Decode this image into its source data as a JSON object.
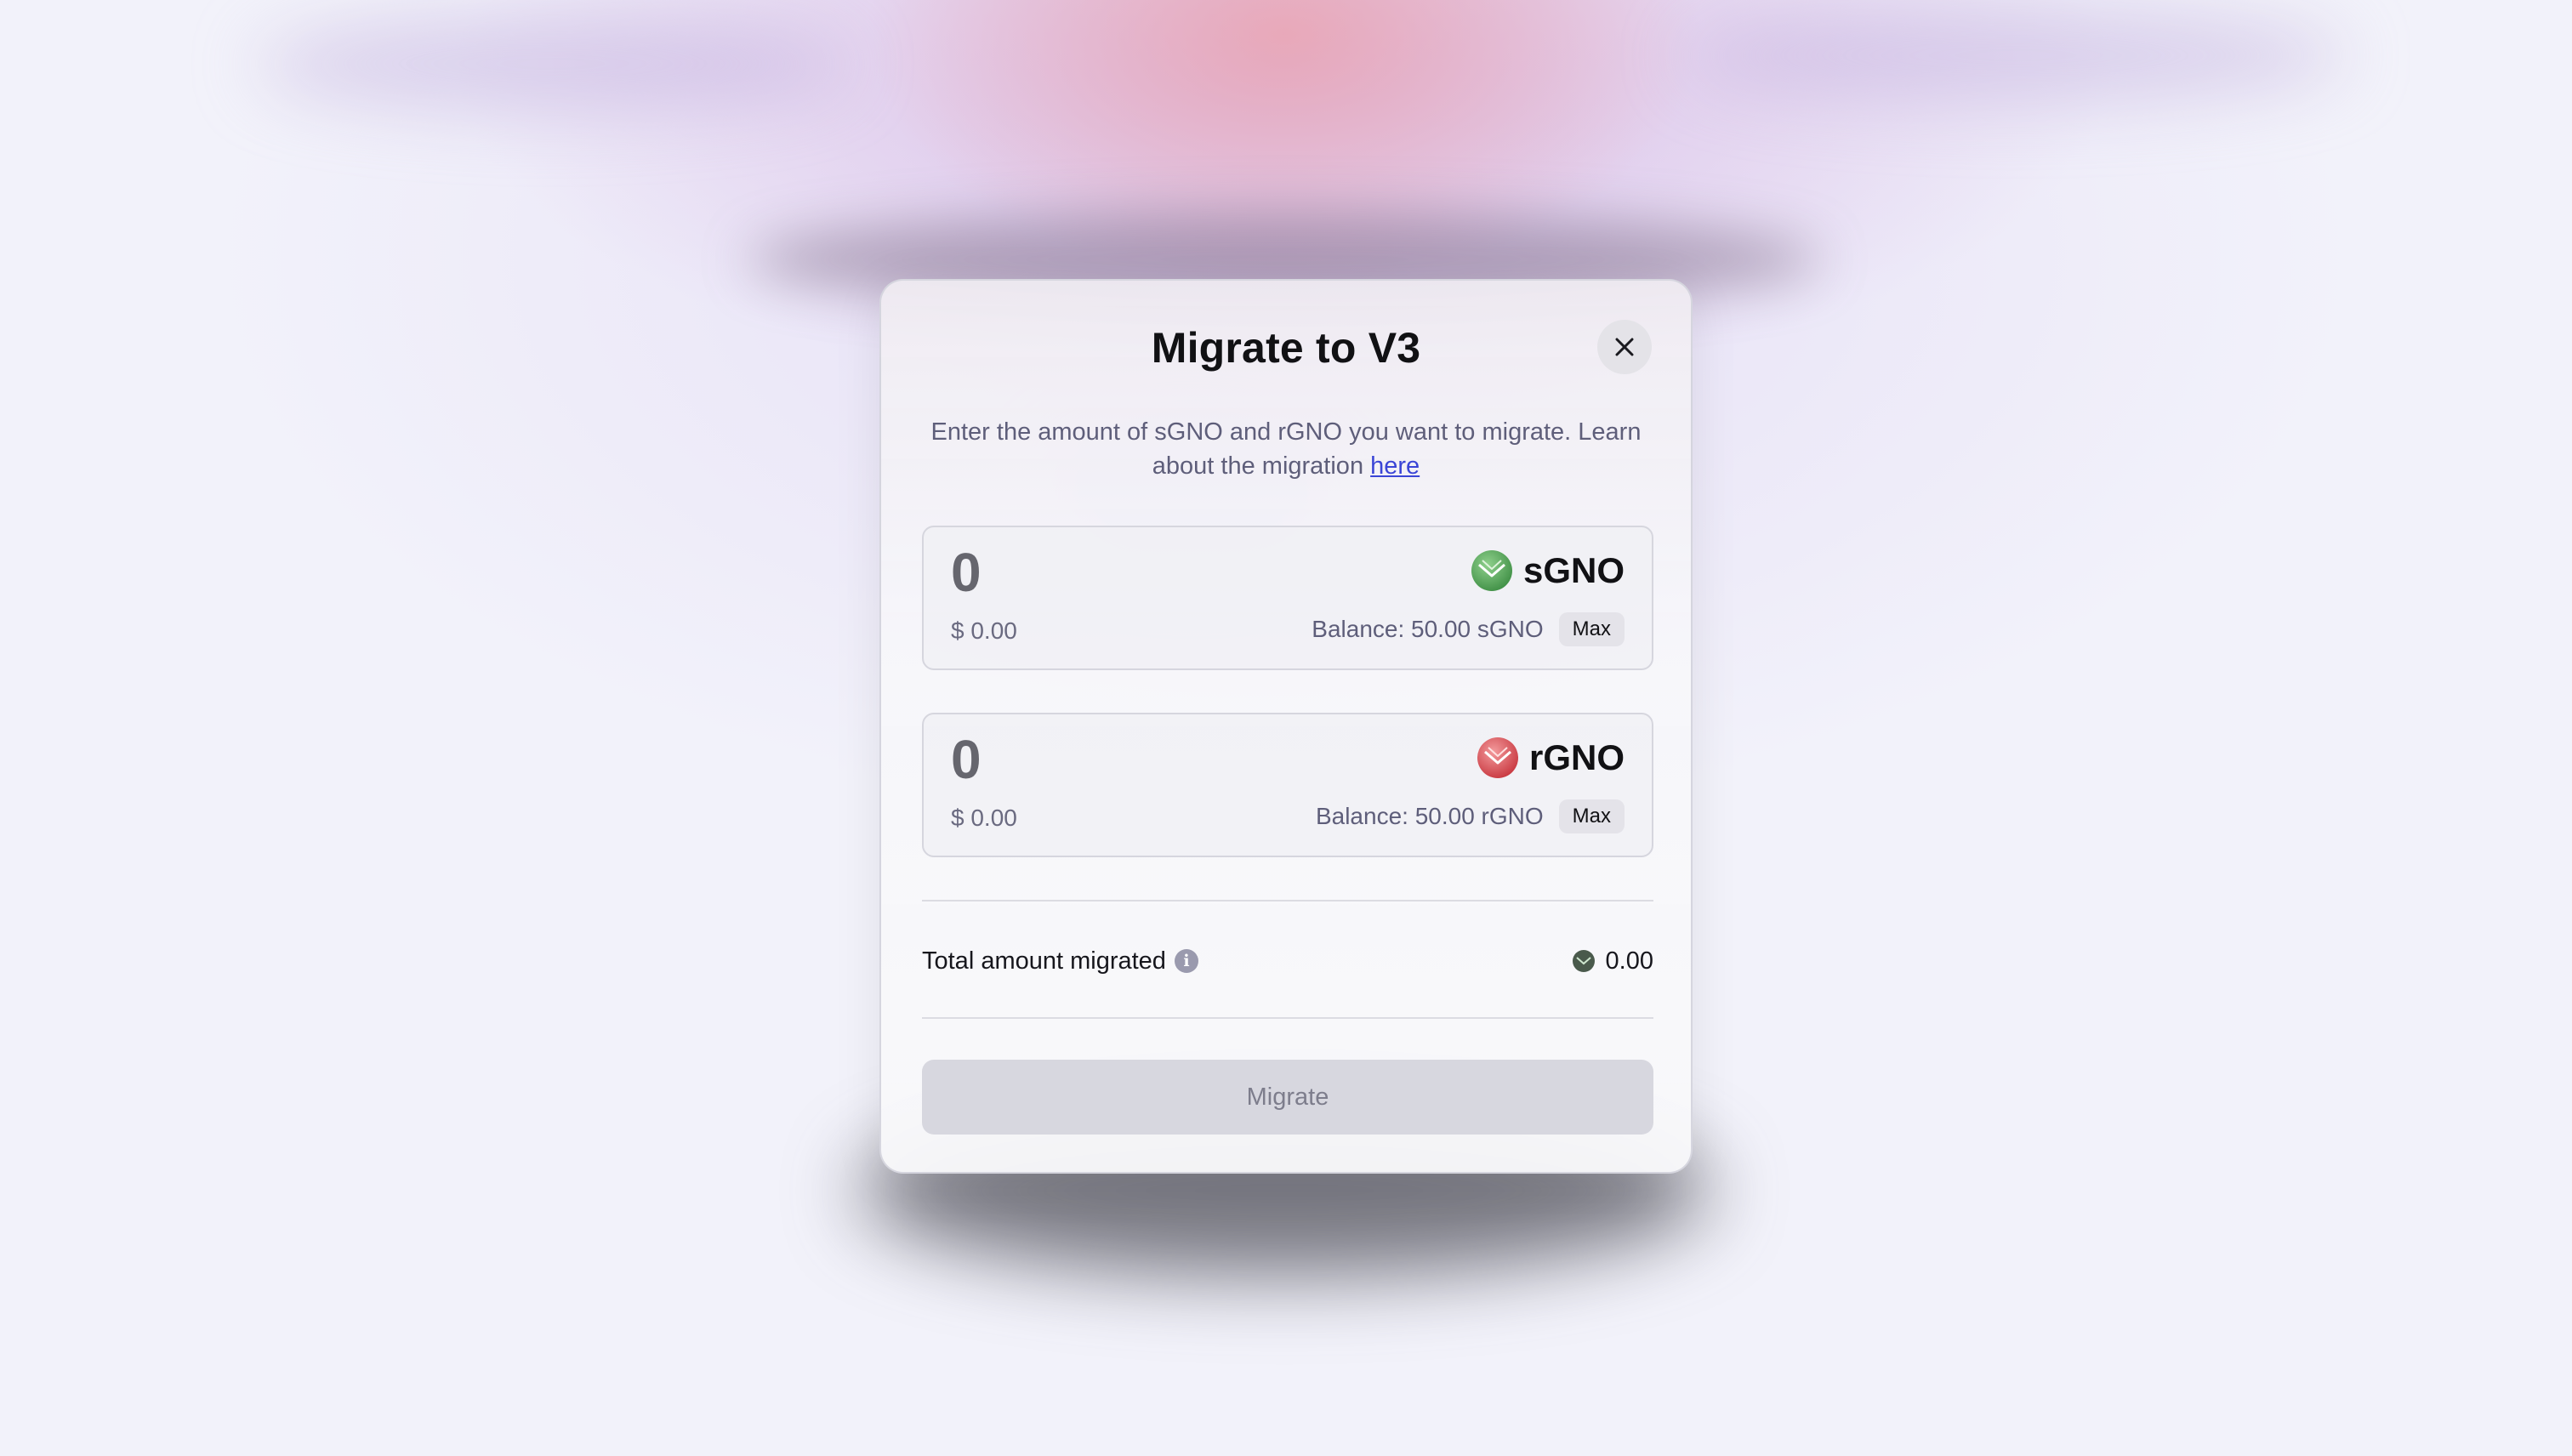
{
  "modal": {
    "title": "Migrate to V3",
    "description": "Enter the amount of sGNO and rGNO you want to migrate. Learn about the migration",
    "learn_link": "here"
  },
  "tokens": [
    {
      "amount_placeholder": "0",
      "usd_value": "$ 0.00",
      "symbol": "sGNO",
      "icon": "sgno-token-icon",
      "icon_color": "#5fa862",
      "balance": "Balance: 50.00 sGNO",
      "max_label": "Max"
    },
    {
      "amount_placeholder": "0",
      "usd_value": "$ 0.00",
      "symbol": "rGNO",
      "icon": "rgno-token-icon",
      "icon_color": "#d9535a",
      "balance": "Balance: 50.00 rGNO",
      "max_label": "Max"
    }
  ],
  "summary": {
    "total_label": "Total amount migrated",
    "total_value": "0.00",
    "info_icon": "info-icon"
  },
  "actions": {
    "migrate_label": "Migrate"
  }
}
